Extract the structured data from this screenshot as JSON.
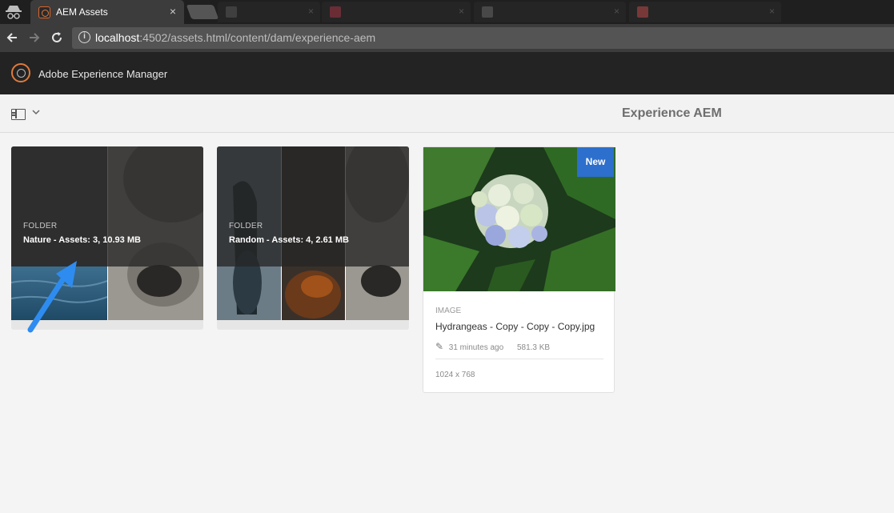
{
  "browser": {
    "active_tab": {
      "title": "AEM Assets",
      "close": "×"
    },
    "background_tabs": [
      {
        "title": "",
        "close": "×"
      },
      {
        "title": "",
        "close": "×"
      },
      {
        "title": "",
        "close": "×"
      },
      {
        "title": "",
        "close": "×"
      }
    ],
    "url_host": "localhost",
    "url_rest": ":4502/assets.html/content/dam/experience-aem"
  },
  "header": {
    "product": "Adobe Experience Manager"
  },
  "actionbar": {
    "title": "Experience AEM"
  },
  "cards": [
    {
      "type": "FOLDER",
      "name": "Nature - Assets: 3, 10.93 MB"
    },
    {
      "type": "FOLDER",
      "name": "Random - Assets: 4, 2.61 MB"
    },
    {
      "type": "IMAGE",
      "badge": "New",
      "name": "Hydrangeas - Copy - Copy - Copy.jpg",
      "modified": "31 minutes ago",
      "size": "581.3 KB",
      "dimensions": "1024 x 768"
    }
  ],
  "icons": {
    "incognito": "incognito-icon",
    "back": "back-arrow-icon",
    "forward": "forward-arrow-icon",
    "reload": "reload-icon",
    "info": "info-icon",
    "aem": "aem-logo-icon",
    "rail": "rail-toggle-icon",
    "chevron": "chevron-down-icon",
    "pencil": "pencil-icon"
  },
  "colors": {
    "brand_orange": "#e07a3c",
    "badge_blue": "#2d6fcc",
    "annotation_arrow": "#2e8cf0"
  }
}
